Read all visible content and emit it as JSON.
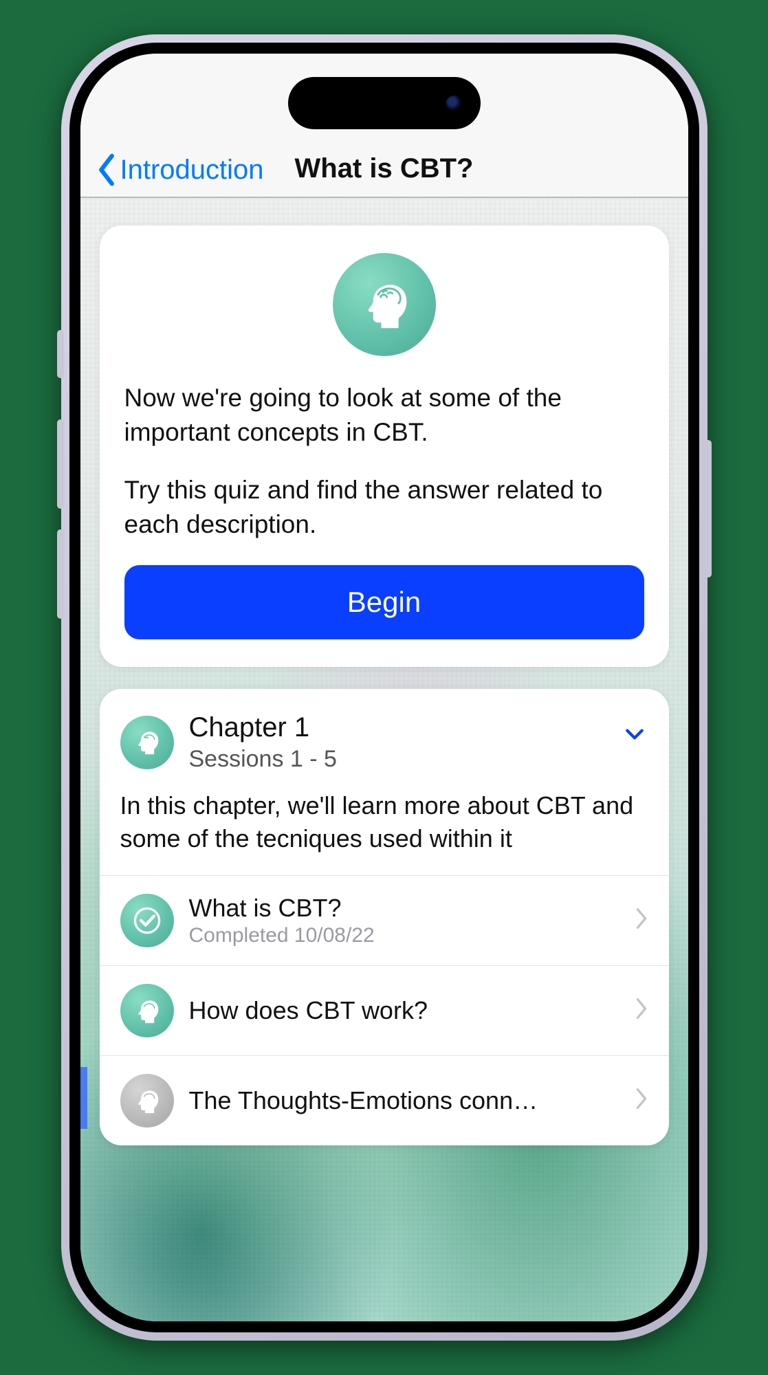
{
  "nav": {
    "back_label": "Introduction",
    "title": "What is CBT?"
  },
  "intro": {
    "para1": "Now we're going to look at some of the important concepts in CBT.",
    "para2": "Try this quiz and find the answer related to each description.",
    "begin_label": "Begin"
  },
  "chapter": {
    "title": "Chapter 1",
    "subtitle": "Sessions 1 - 5",
    "description": "In this chapter, we'll learn more about CBT and some of the tecniques used within it",
    "sessions": [
      {
        "title": "What is CBT?",
        "subtitle": "Completed 10/08/22",
        "status": "completed"
      },
      {
        "title": "How does CBT work?",
        "subtitle": "",
        "status": "available"
      },
      {
        "title": "The Thoughts-Emotions conn…",
        "subtitle": "",
        "status": "locked"
      }
    ]
  }
}
